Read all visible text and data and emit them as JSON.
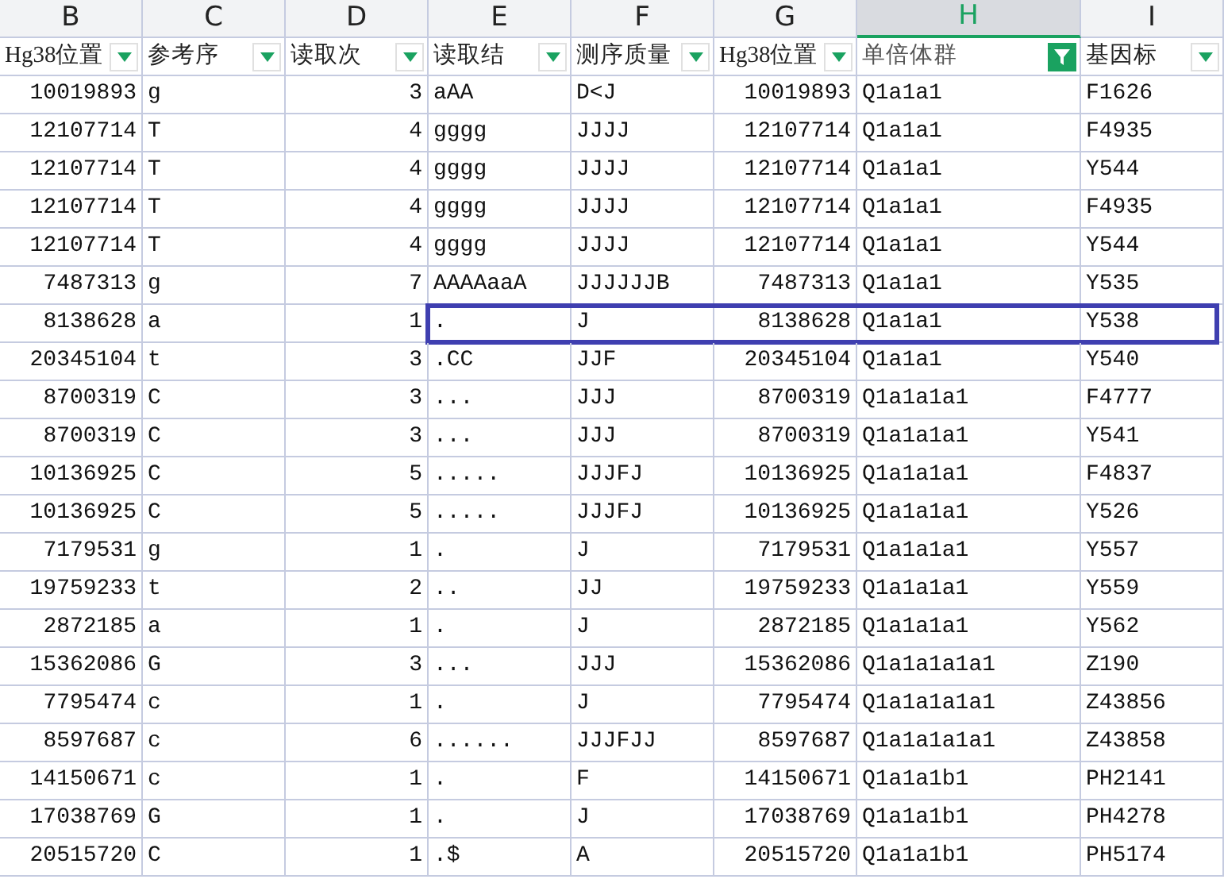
{
  "columns": [
    {
      "letter": "B",
      "header": "Hg38位置",
      "kind": "number",
      "selected": false,
      "filter_active": false
    },
    {
      "letter": "C",
      "header": "参考序",
      "kind": "text",
      "selected": false,
      "filter_active": false
    },
    {
      "letter": "D",
      "header": "读取次",
      "kind": "number",
      "selected": false,
      "filter_active": false
    },
    {
      "letter": "E",
      "header": "读取结",
      "kind": "text",
      "selected": false,
      "filter_active": false
    },
    {
      "letter": "F",
      "header": "测序质量",
      "kind": "text",
      "selected": false,
      "filter_active": false
    },
    {
      "letter": "G",
      "header": "Hg38位置",
      "kind": "number",
      "selected": false,
      "filter_active": false
    },
    {
      "letter": "H",
      "header": "单倍体群",
      "kind": "text",
      "selected": true,
      "filter_active": true
    },
    {
      "letter": "I",
      "header": "基因标",
      "kind": "text",
      "selected": false,
      "filter_active": false
    }
  ],
  "rows": [
    {
      "selected": false,
      "cells": [
        "10019893",
        "g",
        "3",
        "aAA",
        "D<J",
        "10019893",
        "Q1a1a1",
        "F1626"
      ]
    },
    {
      "selected": false,
      "cells": [
        "12107714",
        "T",
        "4",
        "gggg",
        "JJJJ",
        "12107714",
        "Q1a1a1",
        "F4935"
      ]
    },
    {
      "selected": false,
      "cells": [
        "12107714",
        "T",
        "4",
        "gggg",
        "JJJJ",
        "12107714",
        "Q1a1a1",
        "Y544"
      ]
    },
    {
      "selected": false,
      "cells": [
        "12107714",
        "T",
        "4",
        "gggg",
        "JJJJ",
        "12107714",
        "Q1a1a1",
        "F4935"
      ]
    },
    {
      "selected": false,
      "cells": [
        "12107714",
        "T",
        "4",
        "gggg",
        "JJJJ",
        "12107714",
        "Q1a1a1",
        "Y544"
      ]
    },
    {
      "selected": false,
      "cells": [
        "7487313",
        "g",
        "7",
        "AAAAaaA",
        "JJJJJJB",
        "7487313",
        "Q1a1a1",
        "Y535"
      ]
    },
    {
      "selected": true,
      "cells": [
        "8138628",
        "a",
        "1",
        ".",
        "J",
        "8138628",
        "Q1a1a1",
        "Y538"
      ]
    },
    {
      "selected": false,
      "cells": [
        "20345104",
        "t",
        "3",
        ".CC",
        "JJF",
        "20345104",
        "Q1a1a1",
        "Y540"
      ]
    },
    {
      "selected": false,
      "cells": [
        "8700319",
        "C",
        "3",
        "...",
        "JJJ",
        "8700319",
        "Q1a1a1a1",
        "F4777"
      ]
    },
    {
      "selected": false,
      "cells": [
        "8700319",
        "C",
        "3",
        "...",
        "JJJ",
        "8700319",
        "Q1a1a1a1",
        "Y541"
      ]
    },
    {
      "selected": false,
      "cells": [
        "10136925",
        "C",
        "5",
        ".....",
        "JJJFJ",
        "10136925",
        "Q1a1a1a1",
        "F4837"
      ]
    },
    {
      "selected": false,
      "cells": [
        "10136925",
        "C",
        "5",
        ".....",
        "JJJFJ",
        "10136925",
        "Q1a1a1a1",
        "Y526"
      ]
    },
    {
      "selected": false,
      "cells": [
        "7179531",
        "g",
        "1",
        ".",
        "J",
        "7179531",
        "Q1a1a1a1",
        "Y557"
      ]
    },
    {
      "selected": false,
      "cells": [
        "19759233",
        "t",
        "2",
        "..",
        "JJ",
        "19759233",
        "Q1a1a1a1",
        "Y559"
      ]
    },
    {
      "selected": false,
      "cells": [
        "2872185",
        "a",
        "1",
        ".",
        "J",
        "2872185",
        "Q1a1a1a1",
        "Y562"
      ]
    },
    {
      "selected": false,
      "cells": [
        "15362086",
        "G",
        "3",
        "...",
        "JJJ",
        "15362086",
        "Q1a1a1a1a1",
        "Z190"
      ]
    },
    {
      "selected": false,
      "cells": [
        "7795474",
        "c",
        "1",
        ".",
        "J",
        "7795474",
        "Q1a1a1a1a1",
        "Z43856"
      ]
    },
    {
      "selected": false,
      "cells": [
        "8597687",
        "c",
        "6",
        "......",
        "JJJFJJ",
        "8597687",
        "Q1a1a1a1a1",
        "Z43858"
      ]
    },
    {
      "selected": false,
      "cells": [
        "14150671",
        "c",
        "1",
        ".",
        "F",
        "14150671",
        "Q1a1a1b1",
        "PH2141"
      ]
    },
    {
      "selected": false,
      "cells": [
        "17038769",
        "G",
        "1",
        ".",
        "J",
        "17038769",
        "Q1a1a1b1",
        "PH4278"
      ]
    },
    {
      "selected": false,
      "cells": [
        "20515720",
        "C",
        "1",
        ".$",
        "A",
        "20515720",
        "Q1a1a1b1",
        "PH5174"
      ]
    }
  ]
}
